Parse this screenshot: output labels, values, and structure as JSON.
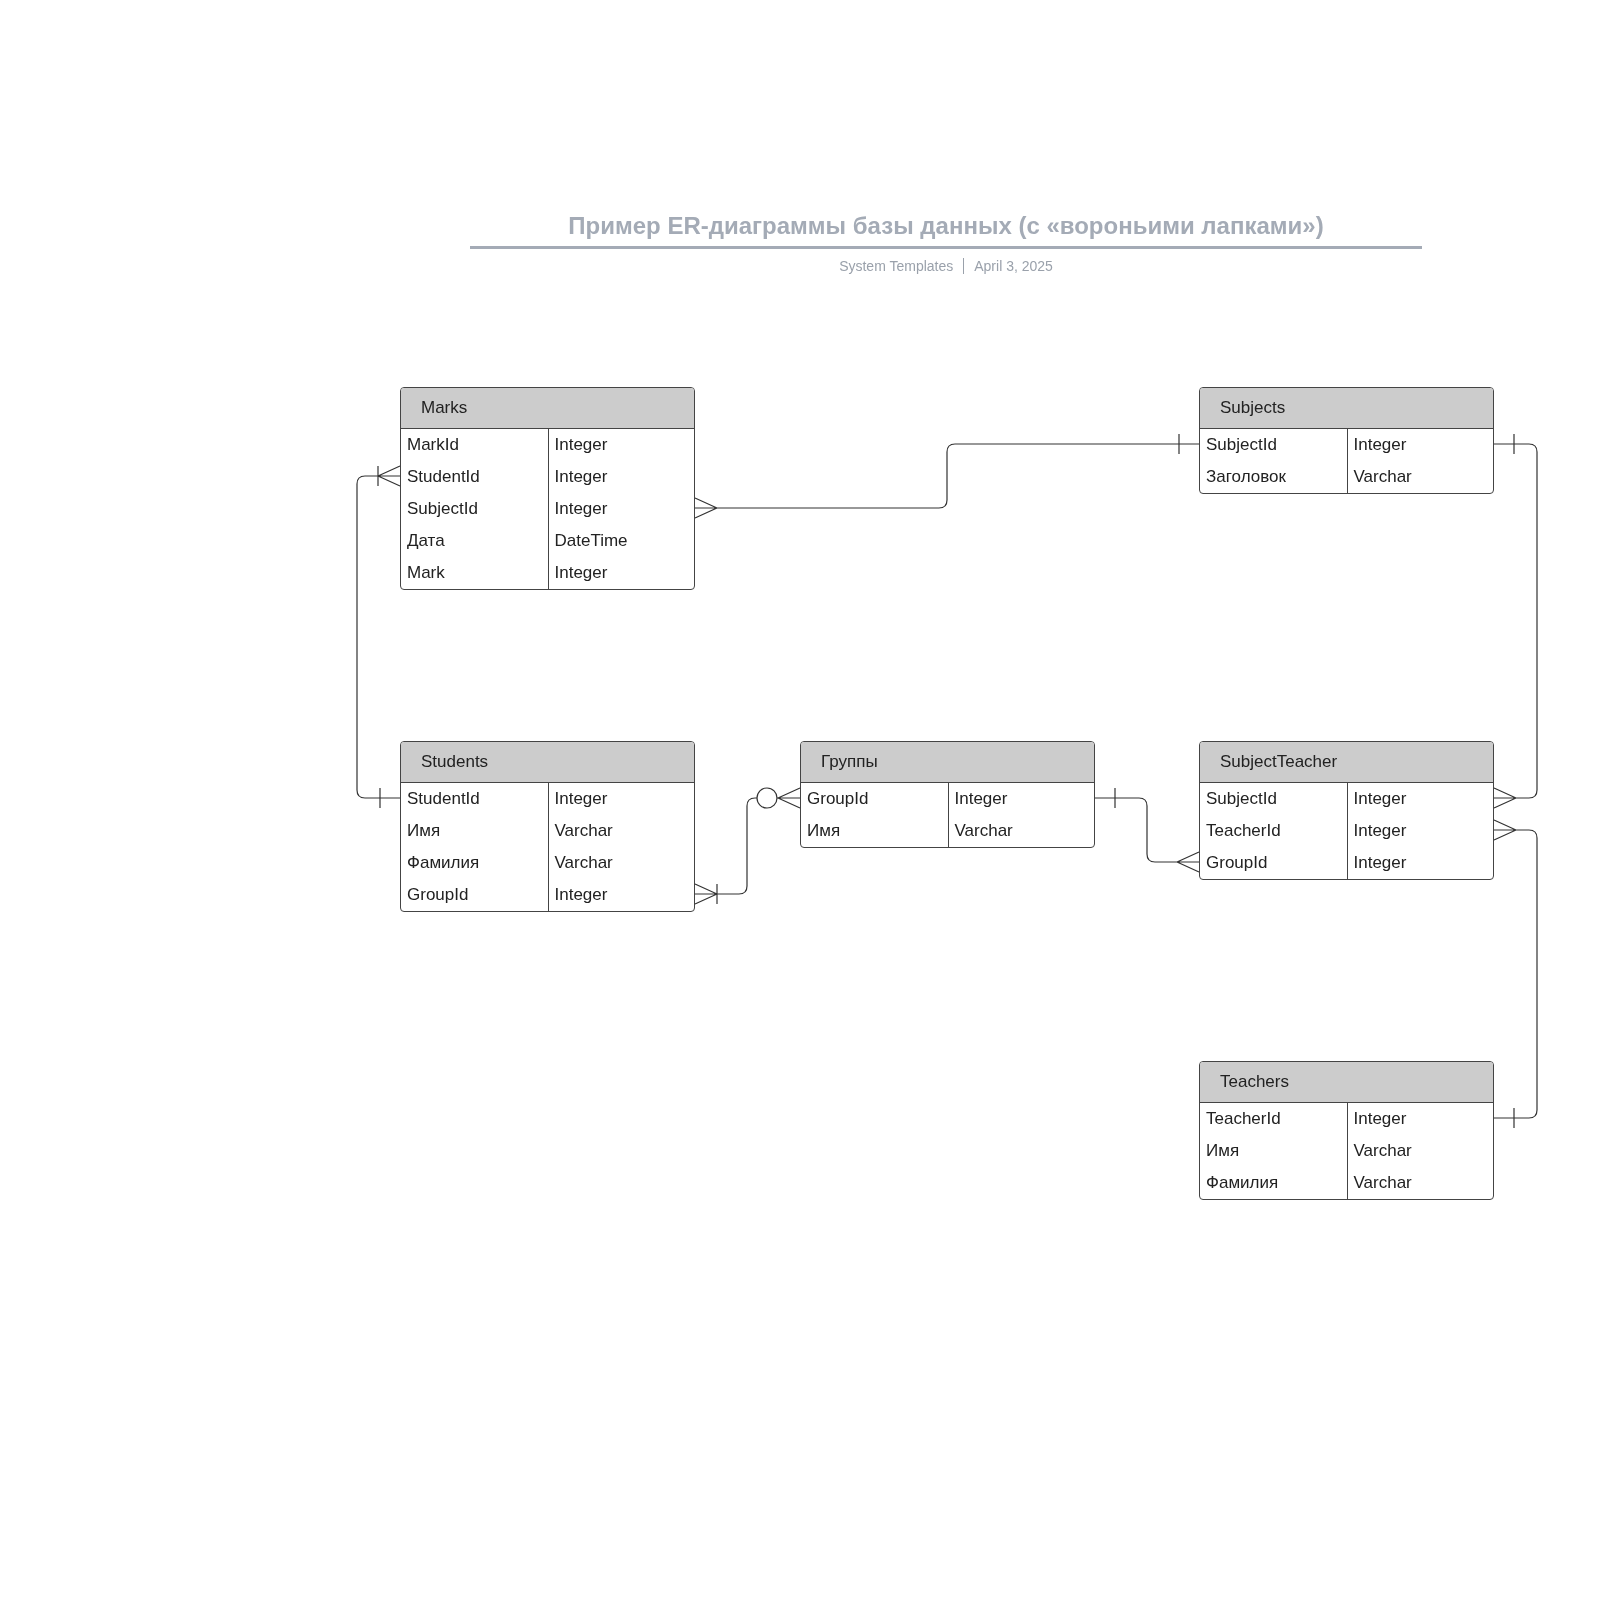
{
  "header": {
    "title": "Пример ER-диаграммы базы данных (с «вороньими лапками»)",
    "author": "System Templates",
    "date": "April 3, 2025"
  },
  "tables": [
    {
      "name": "Marks",
      "rows": [
        [
          "MarkId",
          "Integer"
        ],
        [
          "StudentId",
          "Integer"
        ],
        [
          "SubjectId",
          "Integer"
        ],
        [
          "Дата",
          "DateTime"
        ],
        [
          "Mark",
          "Integer"
        ]
      ]
    },
    {
      "name": "Subjects",
      "rows": [
        [
          "SubjectId",
          "Integer"
        ],
        [
          "Заголовок",
          "Varchar"
        ]
      ]
    },
    {
      "name": "Students",
      "rows": [
        [
          "StudentId",
          "Integer"
        ],
        [
          "Имя",
          "Varchar"
        ],
        [
          "Фамилия",
          "Varchar"
        ],
        [
          "GroupId",
          "Integer"
        ]
      ]
    },
    {
      "name": "Группы",
      "rows": [
        [
          "GroupId",
          "Integer"
        ],
        [
          "Имя",
          "Varchar"
        ]
      ]
    },
    {
      "name": "SubjectTeacher",
      "rows": [
        [
          "SubjectId",
          "Integer"
        ],
        [
          "TeacherId",
          "Integer"
        ],
        [
          "GroupId",
          "Integer"
        ]
      ]
    },
    {
      "name": "Teachers",
      "rows": [
        [
          "TeacherId",
          "Integer"
        ],
        [
          "Имя",
          "Varchar"
        ],
        [
          "Фамилия",
          "Varchar"
        ]
      ]
    }
  ],
  "relationships": [
    {
      "ends": [
        {
          "kind": "many"
        },
        {
          "kind": "one"
        }
      ]
    },
    {
      "ends": [
        {
          "kind": "onemany"
        },
        {
          "kind": "one"
        }
      ]
    },
    {
      "ends": [
        {
          "kind": "onemany"
        },
        {
          "kind": "zeromany"
        }
      ]
    },
    {
      "ends": [
        {
          "kind": "one"
        },
        {
          "kind": "many"
        }
      ]
    },
    {
      "ends": [
        {
          "kind": "one"
        },
        {
          "kind": "many"
        }
      ]
    },
    {
      "ends": [
        {
          "kind": "many"
        },
        {
          "kind": "one"
        }
      ]
    }
  ]
}
